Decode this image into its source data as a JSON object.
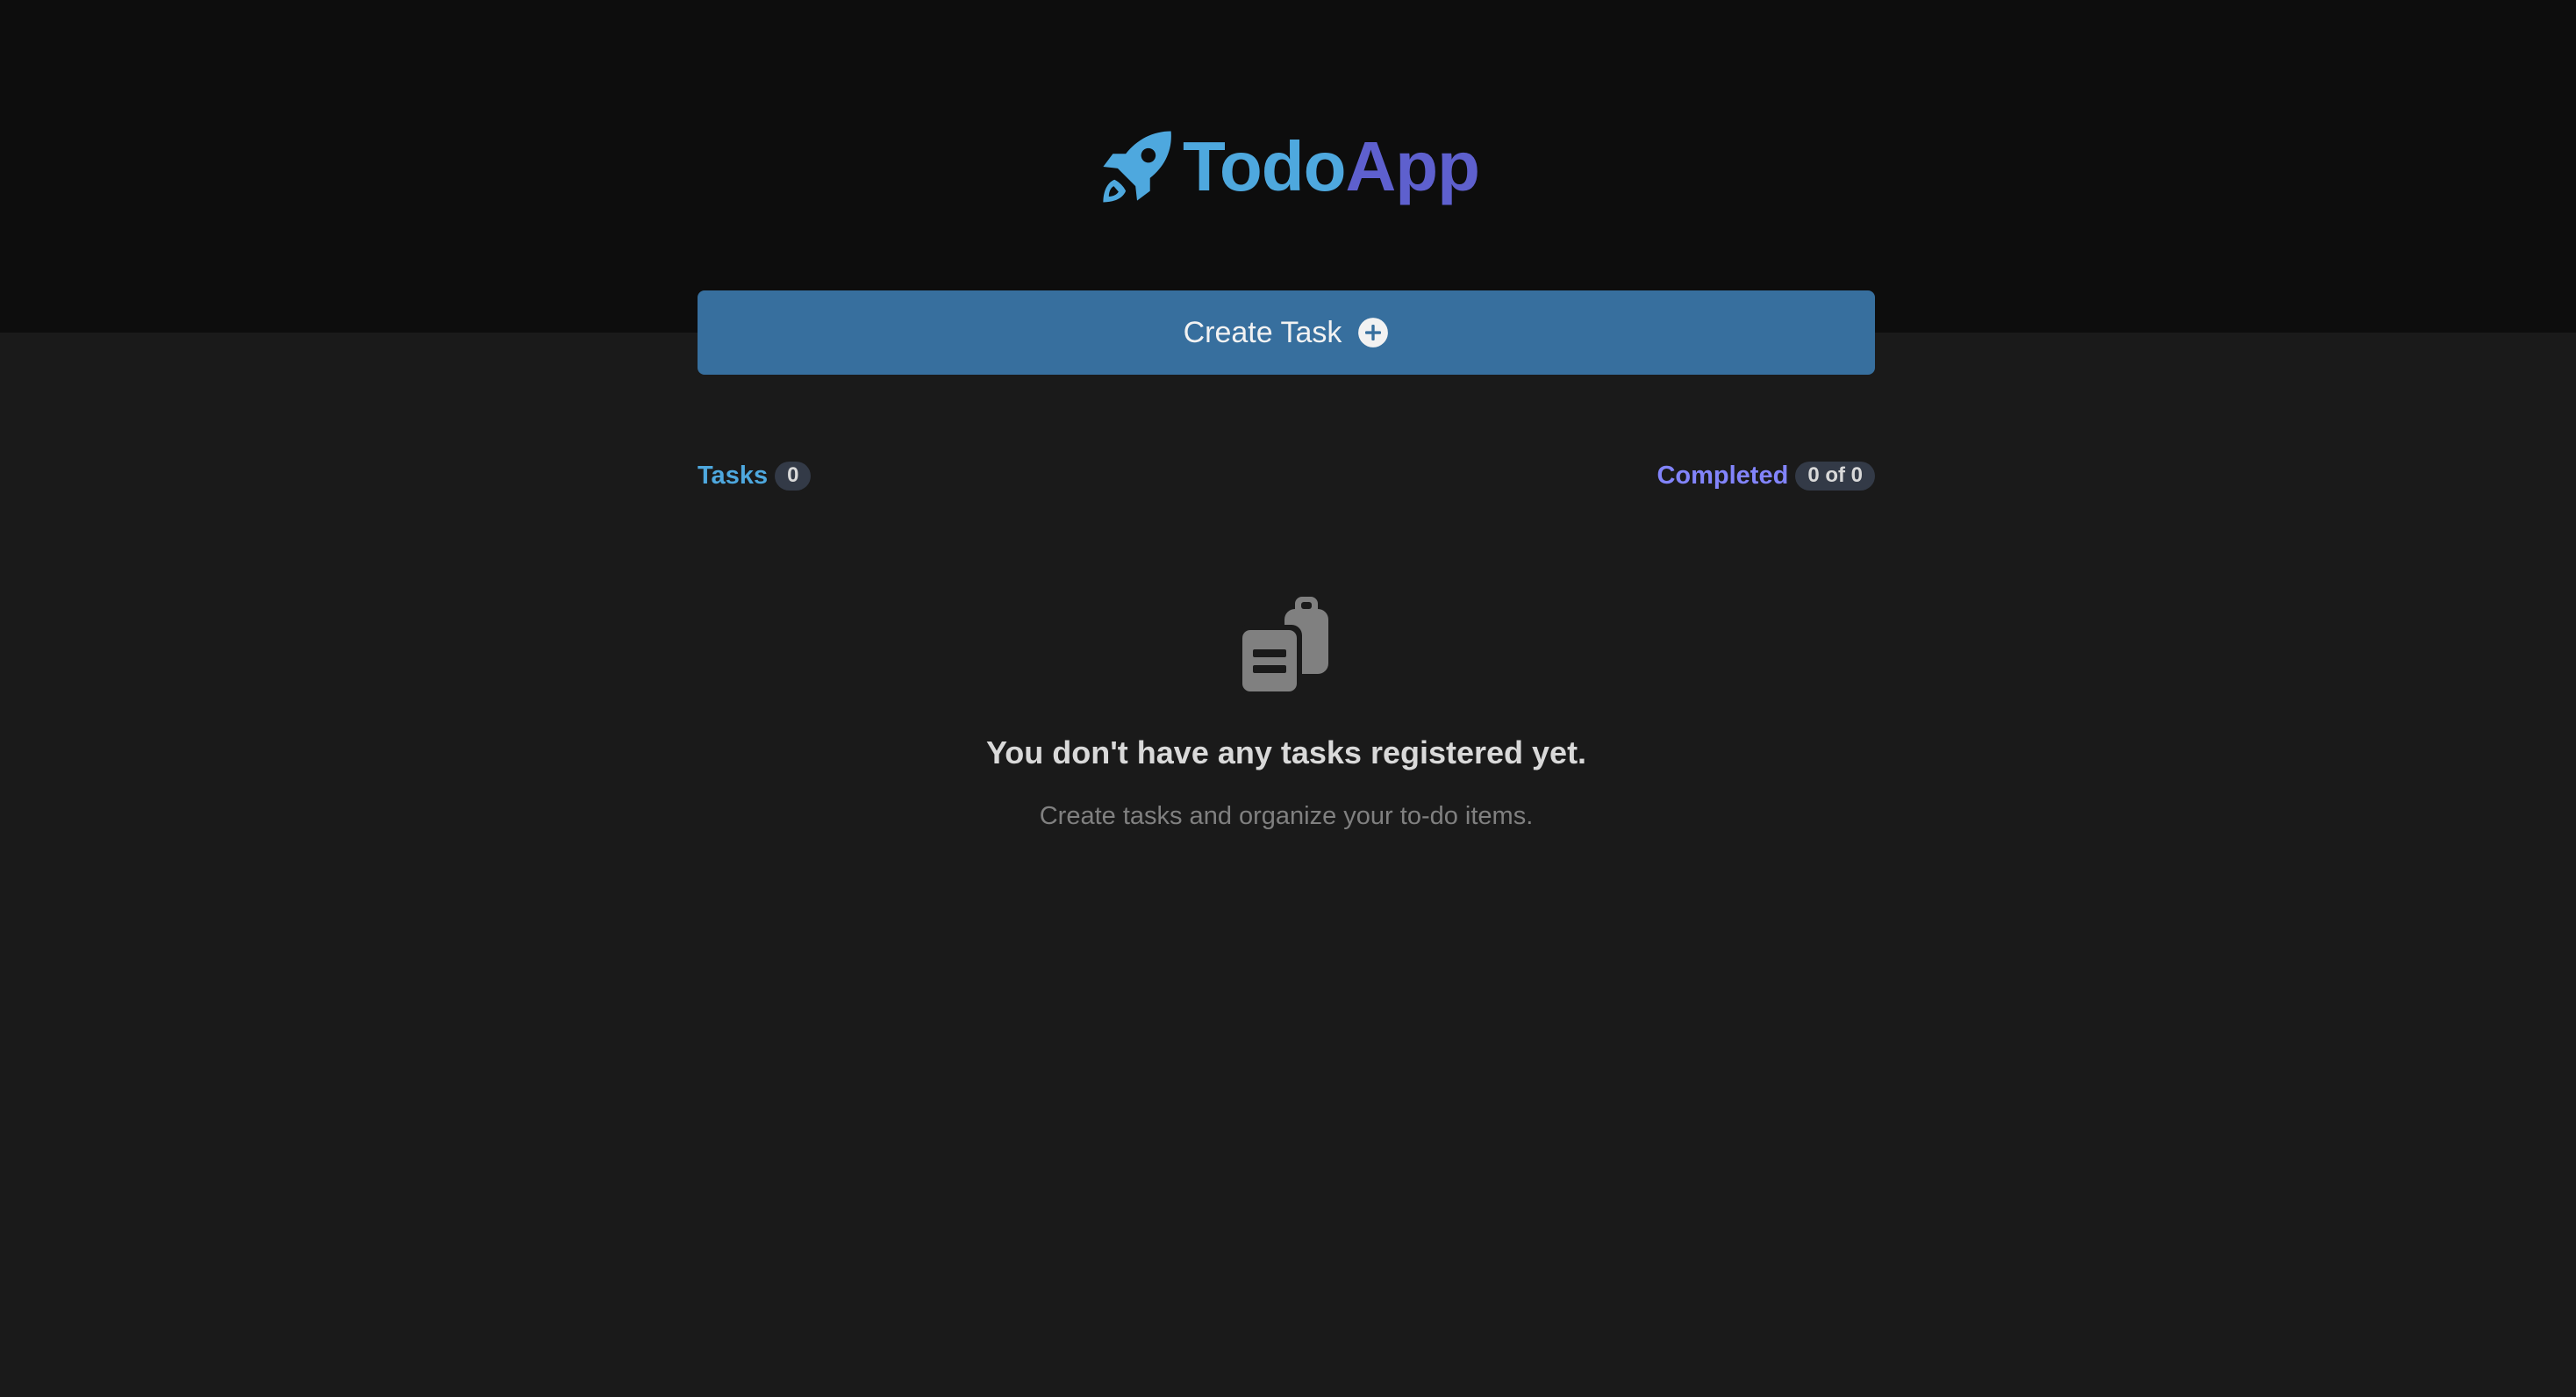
{
  "app": {
    "title_part1": "Todo",
    "title_part2": "App",
    "icon": "rocket-icon"
  },
  "toolbar": {
    "create_label": "Create Task",
    "create_icon": "plus-circle-icon"
  },
  "summary": {
    "tasks_label": "Tasks",
    "tasks_count": "0",
    "completed_label": "Completed",
    "completed_count": "0 of 0"
  },
  "empty_state": {
    "icon": "clipboard-icon",
    "title": "You don't have any tasks registered yet.",
    "subtitle": "Create tasks and organize your to-do items."
  },
  "colors": {
    "header_bg": "#0d0d0d",
    "page_bg": "#1a1a1a",
    "button_bg": "#376f9e",
    "accent_blue": "#4ea8de",
    "accent_purple": "#5e60ce",
    "completed_purple": "#8284fa",
    "badge_bg": "#333a47"
  }
}
